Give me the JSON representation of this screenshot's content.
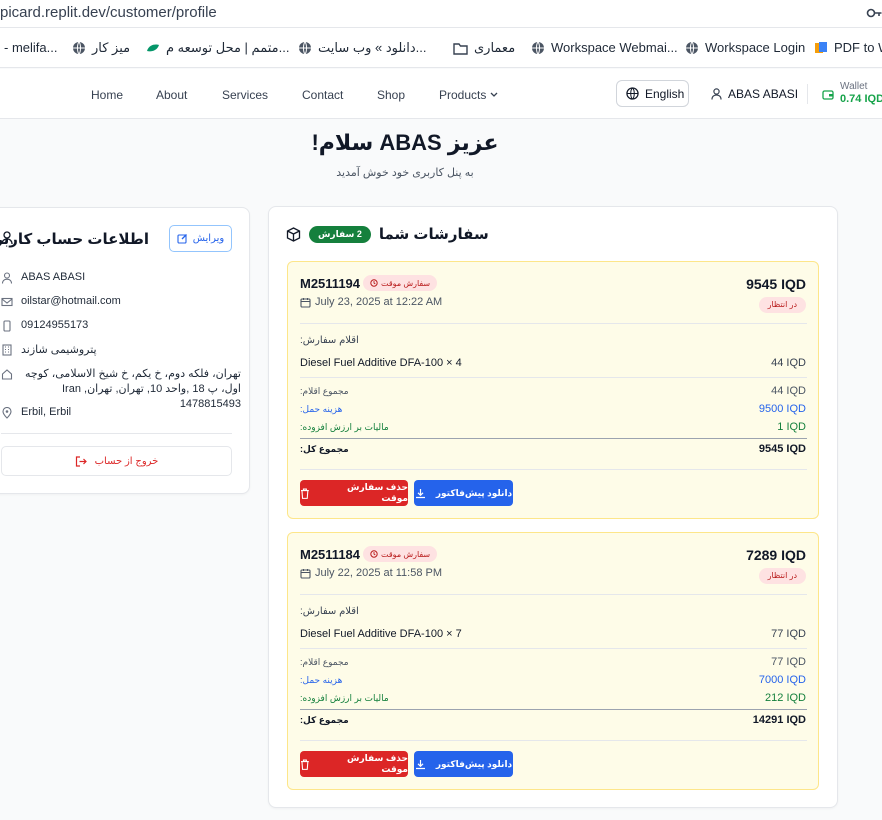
{
  "browser": {
    "url": "picard.replit.dev/customer/profile",
    "bookmarks": [
      {
        "label": "- melifa...",
        "icon": "none"
      },
      {
        "label": "میز کار",
        "icon": "globe-icon"
      },
      {
        "label": "متمم | محل توسعه م...",
        "icon": "leaf-icon"
      },
      {
        "label": "دانلود » وب سایت...",
        "icon": "globe-icon"
      },
      {
        "label": "معماری",
        "icon": "folder-icon"
      },
      {
        "label": "Workspace Webmai...",
        "icon": "globe-icon"
      },
      {
        "label": "Workspace Login",
        "icon": "globe-icon"
      },
      {
        "label": "PDF to W",
        "icon": "pdf-icon"
      }
    ]
  },
  "nav": {
    "links": [
      "Home",
      "About",
      "Services",
      "Contact",
      "Shop",
      "Products"
    ],
    "language": "English",
    "user_name": "ABAS ABASI",
    "wallet_label": "Wallet",
    "wallet_amount": "0.74 IQD"
  },
  "greeting": {
    "title": "عزیز ABAS سلام!",
    "subtitle": "به پنل کاربری خود خوش آمدید"
  },
  "account": {
    "title": "اطلاعات حساب کاربری",
    "edit_label": "ویرایش",
    "name": "ABAS ABASI",
    "email": "oilstar@hotmail.com",
    "phone": "09124955173",
    "company": "پتروشیمی شازند",
    "address": "تهران، فلکه دوم، خ یکم، خ شیخ الاسلامی، کوچه اول، پ 18 ,واحد 10, تهران, تهران, Iran 1478815493",
    "city": "Erbil, Erbil",
    "logout_label": "خروج از حساب"
  },
  "orders": {
    "title": "سفارشات شما",
    "count_badge": "2 سفارش",
    "items_label": "اقلام سفارش:",
    "subtotal_label": "مجموع اقلام:",
    "shipping_label": "هزینه حمل:",
    "tax_label": "مالیات بر ارزش افزوده:",
    "grand_label": "مجموع کل:",
    "temp_badge": "سفارش موقت",
    "pending_badge": "در انتظار",
    "delete_label": "حذف سفارش موقت",
    "download_label": "دانلود پیش‌فاکتور",
    "list": [
      {
        "id": "M2511194",
        "date": "July 23, 2025 at 12:22 AM",
        "total": "9545 IQD",
        "item_name": "Diesel Fuel Additive DFA-100 × 4",
        "item_price": "44 IQD",
        "subtotal": "44 IQD",
        "shipping": "9500 IQD",
        "tax": "1 IQD",
        "grand_total": "9545 IQD"
      },
      {
        "id": "M2511184",
        "date": "July 22, 2025 at 11:58 PM",
        "total": "7289 IQD",
        "item_name": "Diesel Fuel Additive DFA-100 × 7",
        "item_price": "77 IQD",
        "subtotal": "77 IQD",
        "shipping": "7000 IQD",
        "tax": "212 IQD",
        "grand_total": "14291 IQD"
      }
    ]
  }
}
